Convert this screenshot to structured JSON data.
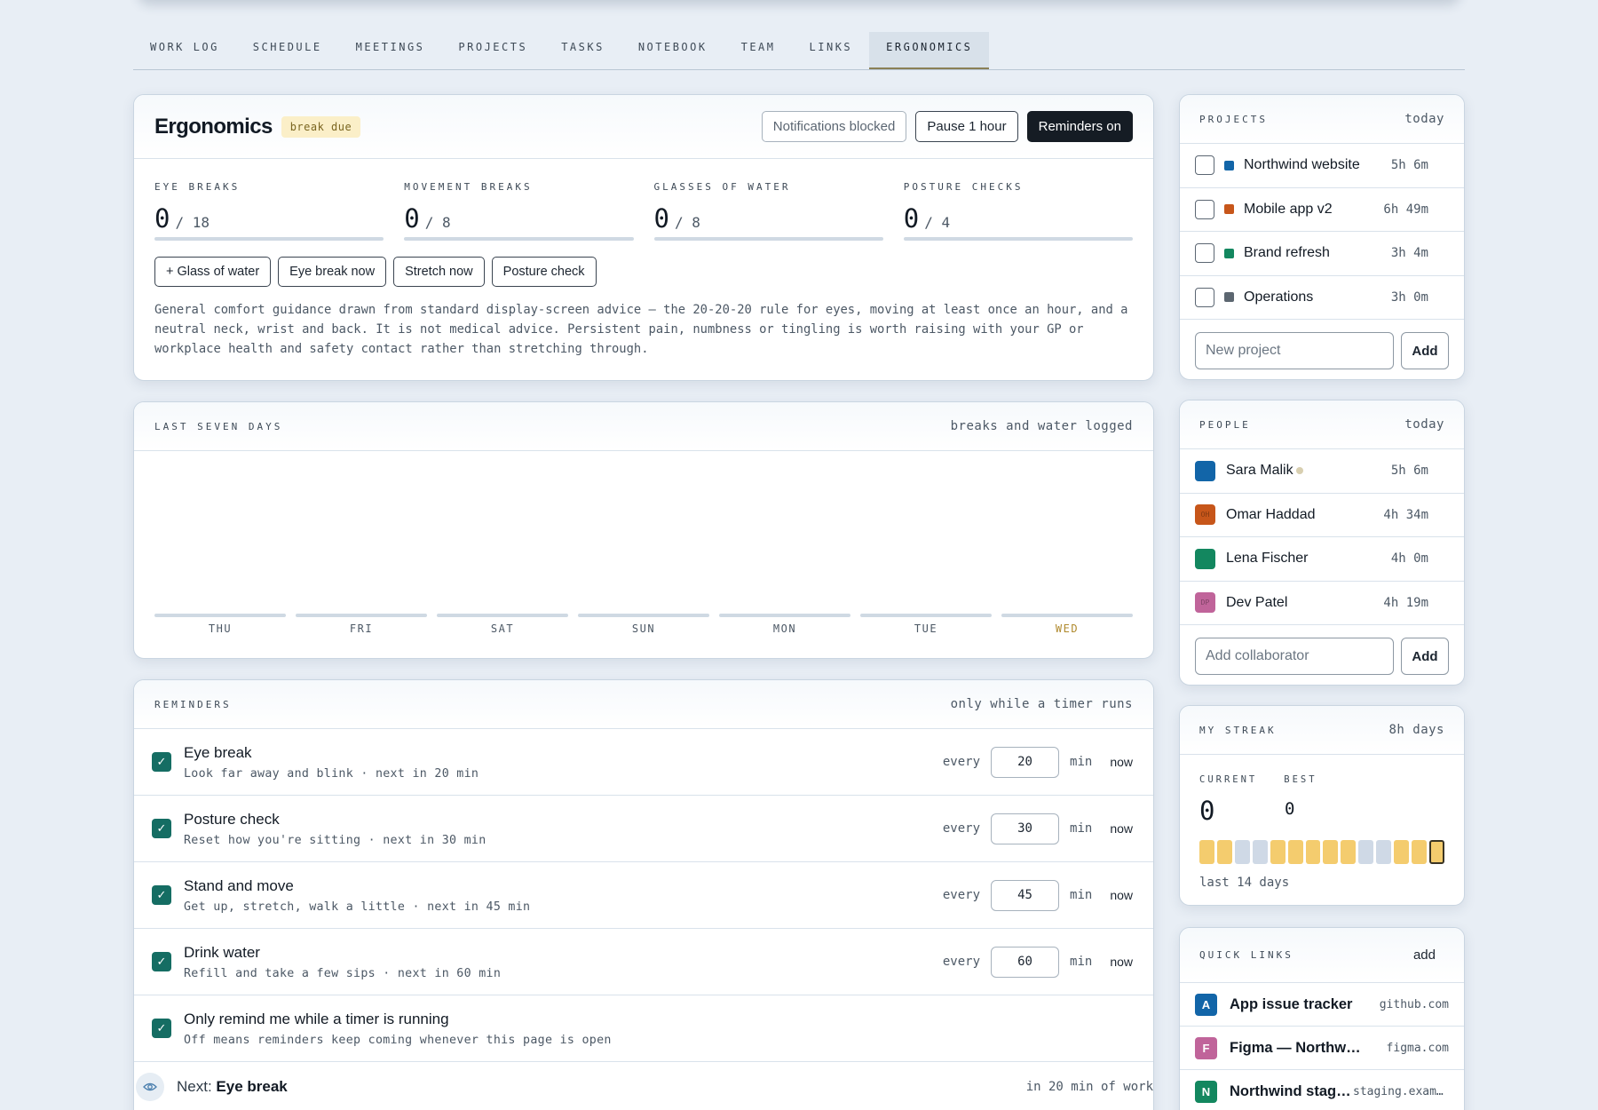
{
  "nav": {
    "tabs": [
      "WORK LOG",
      "SCHEDULE",
      "MEETINGS",
      "PROJECTS",
      "TASKS",
      "NOTEBOOK",
      "TEAM",
      "LINKS",
      "ERGONOMICS"
    ],
    "active_tab": "ERGONOMICS"
  },
  "ergonomics": {
    "title": "Ergonomics",
    "badge": "break due",
    "buttons": {
      "notifications": "Notifications blocked",
      "pause": "Pause 1 hour",
      "reminders": "Reminders on"
    },
    "stats": [
      {
        "label": "EYE BREAKS",
        "value": "0",
        "of": "/ 18"
      },
      {
        "label": "MOVEMENT BREAKS",
        "value": "0",
        "of": "/ 8"
      },
      {
        "label": "GLASSES OF WATER",
        "value": "0",
        "of": "/ 8"
      },
      {
        "label": "POSTURE CHECKS",
        "value": "0",
        "of": "/ 4"
      }
    ],
    "actions": [
      "+ Glass of water",
      "Eye break now",
      "Stretch now",
      "Posture check"
    ],
    "guidance": "General comfort guidance drawn from standard display-screen advice — the 20-20-20 rule for eyes, moving at least once an hour, and a neutral neck, wrist and back. It is not medical advice. Persistent pain, numbness or tingling is worth raising with your GP or workplace health and safety contact rather than stretching through."
  },
  "week": {
    "title": "LAST SEVEN DAYS",
    "note": "breaks and water logged",
    "days": [
      "THU",
      "FRI",
      "SAT",
      "SUN",
      "MON",
      "TUE",
      "WED"
    ],
    "today": "WED",
    "accent_today": "#b08a2e"
  },
  "reminders": {
    "title": "REMINDERS",
    "note": "only while a timer runs",
    "every_label": "every",
    "unit_label": "min",
    "now_label": "now",
    "items": [
      {
        "title": "Eye break",
        "sub": "Look far away and blink · next in 20 min",
        "minutes": "20",
        "checked": true
      },
      {
        "title": "Posture check",
        "sub": "Reset how you're sitting · next in 30 min",
        "minutes": "30",
        "checked": true
      },
      {
        "title": "Stand and move",
        "sub": "Get up, stretch, walk a little · next in 45 min",
        "minutes": "45",
        "checked": true
      },
      {
        "title": "Drink water",
        "sub": "Refill and take a few sips · next in 60 min",
        "minutes": "60",
        "checked": true
      }
    ],
    "timer_only": {
      "title": "Only remind me while a timer is running",
      "sub": "Off means reminders keep coming whenever this page is open",
      "checked": true
    },
    "next": {
      "prefix": "Next:",
      "name": "Eye break",
      "when": "in 20 min of work",
      "icon": "eye-icon"
    },
    "check_color": "#156d63"
  },
  "projects": {
    "title": "PROJECTS",
    "period": "today",
    "items": [
      {
        "name": "Northwind website",
        "time": "5h 6m",
        "color": "#1265a8"
      },
      {
        "name": "Mobile app v2",
        "time": "6h 49m",
        "color": "#c7561a"
      },
      {
        "name": "Brand refresh",
        "time": "3h 4m",
        "color": "#13875f"
      },
      {
        "name": "Operations",
        "time": "3h 0m",
        "color": "#5c6670"
      }
    ],
    "input_placeholder": "New project",
    "add_label": "Add"
  },
  "people": {
    "title": "PEOPLE",
    "period": "today",
    "items": [
      {
        "name": "Sara Malik",
        "time": "5h 6m",
        "color": "#1265a8",
        "initials": "",
        "status_dot": true
      },
      {
        "name": "Omar Haddad",
        "time": "4h 34m",
        "color": "#c7561a",
        "initials": "OH",
        "status_dot": false
      },
      {
        "name": "Lena Fischer",
        "time": "4h 0m",
        "color": "#13875f",
        "initials": "",
        "status_dot": false
      },
      {
        "name": "Dev Patel",
        "time": "4h 19m",
        "color": "#c0649a",
        "initials": "DP",
        "status_dot": false
      }
    ],
    "input_placeholder": "Add collaborator",
    "add_label": "Add"
  },
  "streak": {
    "title": "MY STREAK",
    "note": "8h days",
    "current_label": "CURRENT",
    "best_label": "BEST",
    "current": "0",
    "best": "0",
    "days": [
      "hit",
      "hit",
      "miss",
      "miss",
      "hit",
      "hit",
      "hit",
      "hit",
      "hit",
      "miss",
      "miss",
      "hit",
      "hit",
      "today"
    ],
    "footer": "last 14 days",
    "colors": {
      "hit": "#f4cc6e",
      "miss": "#cfd9e6",
      "today_border": "#3a3424"
    }
  },
  "links": {
    "title": "QUICK LINKS",
    "add_label": "add",
    "items": [
      {
        "letter": "A",
        "name": "App issue tracker",
        "host": "github.com",
        "color": "#1265a8"
      },
      {
        "letter": "F",
        "name": "Figma — Northwind",
        "host": "figma.com",
        "color": "#c0649a"
      },
      {
        "letter": "N",
        "name": "Northwind staging",
        "host": "staging.example.com",
        "color": "#13875f"
      }
    ]
  }
}
